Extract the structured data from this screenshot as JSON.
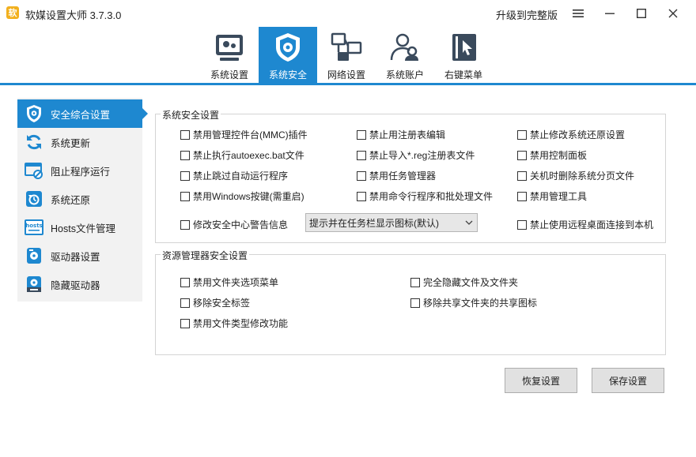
{
  "window": {
    "app_icon_glyph": "软",
    "title": "软媒设置大师 3.7.3.0",
    "upgrade_label": "升级到完整版"
  },
  "colors": {
    "accent": "#1e88d0",
    "sidebar_bg": "#f2f2f2",
    "icon_dark": "#3a4a5c"
  },
  "tabs": [
    {
      "label": "系统设置",
      "icon": "gear-monitor-icon",
      "active": false
    },
    {
      "label": "系统安全",
      "icon": "shield-gear-icon",
      "active": true
    },
    {
      "label": "网络设置",
      "icon": "network-icon",
      "active": false
    },
    {
      "label": "系统账户",
      "icon": "users-icon",
      "active": false
    },
    {
      "label": "右键菜单",
      "icon": "cursor-menu-icon",
      "active": false
    }
  ],
  "sidebar": {
    "items": [
      {
        "label": "安全综合设置",
        "icon": "shield-icon",
        "active": true
      },
      {
        "label": "系统更新",
        "icon": "refresh-icon",
        "active": false
      },
      {
        "label": "阻止程序运行",
        "icon": "block-window-icon",
        "active": false
      },
      {
        "label": "系统还原",
        "icon": "restore-icon",
        "active": false
      },
      {
        "label": "Hosts文件管理",
        "icon": "hosts-icon",
        "active": false
      },
      {
        "label": "驱动器设置",
        "icon": "drive-icon",
        "active": false
      },
      {
        "label": "隐藏驱动器",
        "icon": "hide-drive-icon",
        "active": false
      }
    ]
  },
  "system_security": {
    "title": "系统安全设置",
    "checkboxes": [
      "禁用管理控件台(MMC)插件",
      "禁止用注册表编辑",
      "禁止修改系统还原设置",
      "禁止执行autoexec.bat文件",
      "禁止导入*.reg注册表文件",
      "禁用控制面板",
      "禁止跳过自动运行程序",
      "禁用任务管理器",
      "关机时删除系统分页文件",
      "禁用Windows按键(需重启)",
      "禁用命令行程序和批处理文件",
      "禁用管理工具"
    ],
    "security_center_label": "修改安全中心警告信息",
    "security_center_select": "提示并在任务栏显示图标(默认)",
    "remote_desktop_label": "禁止使用远程桌面连接到本机"
  },
  "explorer_security": {
    "title": "资源管理器安全设置",
    "checkboxes": [
      "禁用文件夹选项菜单",
      "完全隐藏文件及文件夹",
      "移除安全标签",
      "移除共享文件夹的共享图标",
      "禁用文件类型修改功能"
    ]
  },
  "buttons": {
    "restore": "恢复设置",
    "save": "保存设置"
  }
}
